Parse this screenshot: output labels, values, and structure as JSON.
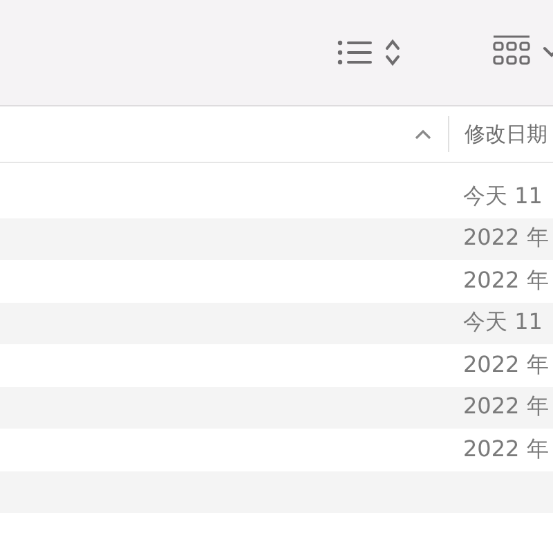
{
  "table": {
    "columns": [
      {
        "sorted": true
      },
      {
        "label": "修改日期",
        "sorted": false
      }
    ],
    "rows": [
      {
        "modified": "今天 11"
      },
      {
        "modified": "2022 年"
      },
      {
        "modified": "2022 年"
      },
      {
        "modified": "今天 11"
      },
      {
        "modified": "2022 年"
      },
      {
        "modified": "2022 年"
      },
      {
        "modified": "2022 年"
      }
    ]
  }
}
